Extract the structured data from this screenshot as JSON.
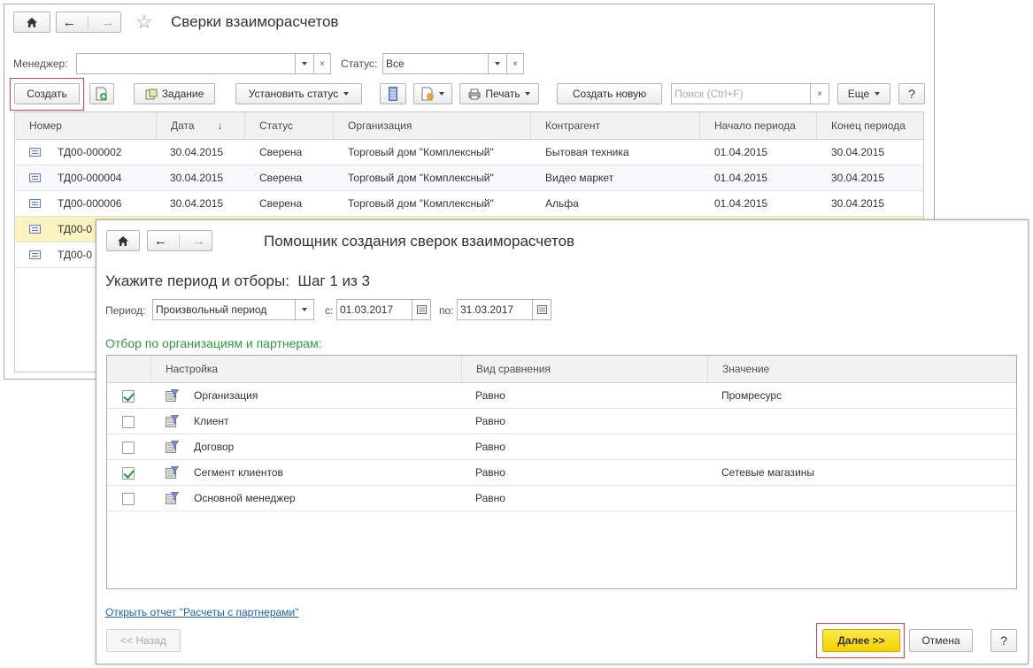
{
  "main_window": {
    "title": "Сверки взаиморасчетов",
    "filters": {
      "manager_label": "Менеджер:",
      "manager_value": "",
      "status_label": "Статус:",
      "status_value": "Все"
    },
    "toolbar": {
      "create": "Создать",
      "task": "Задание",
      "set_status": "Установить статус",
      "print": "Печать",
      "create_new": "Создать новую",
      "search_placeholder": "Поиск (Ctrl+F)",
      "more": "Еще",
      "help": "?"
    },
    "table": {
      "columns": [
        "Номер",
        "Дата",
        "Статус",
        "Организация",
        "Контрагент",
        "Начало периода",
        "Конец периода"
      ],
      "rows": [
        {
          "number": "ТД00-000002",
          "date": "30.04.2015",
          "status": "Сверена",
          "org": "Торговый дом \"Комплексный\"",
          "partner": "Бытовая техника",
          "start": "01.04.2015",
          "end": "30.04.2015"
        },
        {
          "number": "ТД00-000004",
          "date": "30.04.2015",
          "status": "Сверена",
          "org": "Торговый дом \"Комплексный\"",
          "partner": "Видео маркет",
          "start": "01.04.2015",
          "end": "30.04.2015"
        },
        {
          "number": "ТД00-000006",
          "date": "30.04.2015",
          "status": "Сверена",
          "org": "Торговый дом \"Комплексный\"",
          "partner": "Альфа",
          "start": "01.04.2015",
          "end": "30.04.2015"
        },
        {
          "number": "ТД00-0",
          "date": "",
          "status": "",
          "org": "",
          "partner": "",
          "start": "",
          "end": ""
        },
        {
          "number": "ТД00-0",
          "date": "",
          "status": "",
          "org": "",
          "partner": "",
          "start": "",
          "end": ""
        }
      ]
    }
  },
  "wizard": {
    "title": "Помощник создания сверок взаиморасчетов",
    "step_heading": "Укажите период и отборы:  Шаг 1 из 3",
    "period_label": "Период:",
    "period_value": "Произвольный период",
    "from_label": "с:",
    "from_value": "01.03.2017",
    "to_label": "по:",
    "to_value": "31.03.2017",
    "filter_heading": "Отбор по организациям и партнерам:",
    "table": {
      "columns": [
        "Настройка",
        "Вид сравнения",
        "Значение"
      ],
      "rows": [
        {
          "checked": true,
          "setting": "Организация",
          "comparison": "Равно",
          "value": "Промресурс"
        },
        {
          "checked": false,
          "setting": "Клиент",
          "comparison": "Равно",
          "value": ""
        },
        {
          "checked": false,
          "setting": "Договор",
          "comparison": "Равно",
          "value": ""
        },
        {
          "checked": true,
          "setting": "Сегмент клиентов",
          "comparison": "Равно",
          "value": "Сетевые магазины"
        },
        {
          "checked": false,
          "setting": "Основной менеджер",
          "comparison": "Равно",
          "value": ""
        }
      ]
    },
    "report_link": "Открыть отчет \"Расчеты с партнерами\"",
    "back": "<< Назад",
    "next": "Далее >>",
    "cancel": "Отмена",
    "help": "?"
  },
  "colors": {
    "highlight_red": "#d9404a",
    "next_yellow": "#f5d90a",
    "selected_row": "#fbf3c0",
    "green_heading": "#2e9a3e",
    "link_blue": "#1a5fb4"
  }
}
